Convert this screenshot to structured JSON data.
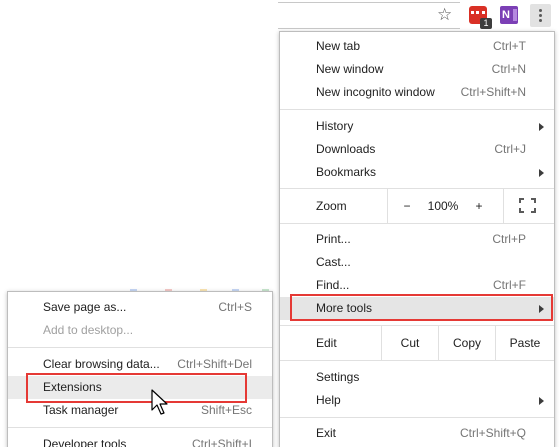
{
  "toolbar": {
    "bookmark_icon": "star-outline-icon",
    "extension_badge": "1",
    "onenote_letter": "N",
    "menu_icon": "kebab-menu-icon"
  },
  "menu": {
    "new_tab": {
      "label": "New tab",
      "shortcut": "Ctrl+T"
    },
    "new_window": {
      "label": "New window",
      "shortcut": "Ctrl+N"
    },
    "new_incognito": {
      "label": "New incognito window",
      "shortcut": "Ctrl+Shift+N"
    },
    "history": {
      "label": "History"
    },
    "downloads": {
      "label": "Downloads",
      "shortcut": "Ctrl+J"
    },
    "bookmarks": {
      "label": "Bookmarks"
    },
    "zoom": {
      "label": "Zoom",
      "minus": "−",
      "value": "100%",
      "plus": "+"
    },
    "print": {
      "label": "Print...",
      "shortcut": "Ctrl+P"
    },
    "cast": {
      "label": "Cast..."
    },
    "find": {
      "label": "Find...",
      "shortcut": "Ctrl+F"
    },
    "more_tools": {
      "label": "More tools"
    },
    "edit": {
      "label": "Edit",
      "cut": "Cut",
      "copy": "Copy",
      "paste": "Paste"
    },
    "settings": {
      "label": "Settings"
    },
    "help": {
      "label": "Help"
    },
    "exit": {
      "label": "Exit",
      "shortcut": "Ctrl+Shift+Q"
    }
  },
  "submenu": {
    "save_page": {
      "label": "Save page as...",
      "shortcut": "Ctrl+S"
    },
    "add_desktop": {
      "label": "Add to desktop..."
    },
    "clear_browsing": {
      "label": "Clear browsing data...",
      "shortcut": "Ctrl+Shift+Del"
    },
    "extensions": {
      "label": "Extensions"
    },
    "task_manager": {
      "label": "Task manager",
      "shortcut": "Shift+Esc"
    },
    "developer_tools": {
      "label": "Developer tools",
      "shortcut": "Ctrl+Shift+I"
    }
  },
  "colors": {
    "highlight_box": "#e53935",
    "onenote": "#7b3fb5",
    "extension_red": "#d93025"
  }
}
